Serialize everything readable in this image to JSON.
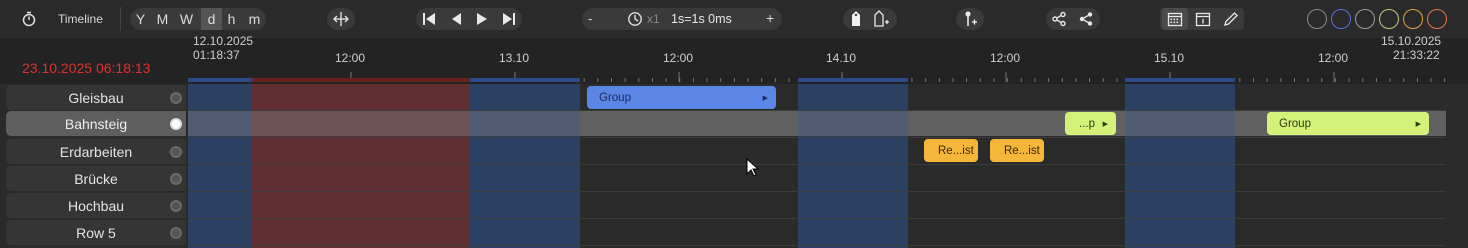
{
  "toolbar": {
    "timeline_label": "Timeline",
    "zoom_levels": [
      "Y",
      "M",
      "W",
      "d",
      "h",
      "m"
    ],
    "active_zoom": "d",
    "speed": {
      "minus": "-",
      "multiplier": "x1",
      "value": "1s=1s 0ms",
      "plus": "+"
    },
    "icons": {
      "stopwatch": "stopwatch-icon",
      "fit": "fit-width-icon",
      "skip_start": "skip-start-icon",
      "prev": "step-back-icon",
      "play": "play-icon",
      "skip_end": "skip-end-icon",
      "clock": "clock-icon",
      "tag": "tag-icon",
      "tag_add": "tag-add-icon",
      "pin_add": "pin-add-icon",
      "share": "share-icon",
      "share_add": "share-add-icon",
      "calendar_week": "calendar-grid-icon",
      "calendar": "calendar-icon",
      "pencil": "pencil-icon"
    },
    "color_circles": [
      "#8a8a8a",
      "#5a6fd6",
      "#9d9d9d",
      "#b9c97a",
      "#e0a43a",
      "#e07a50"
    ]
  },
  "ruler": {
    "current_time": "23.10.2025 06:18:13",
    "current_time_color": "#e03030",
    "start_date": "12.10.2025",
    "start_time": "01:18:37",
    "end_date": "15.10.2025",
    "end_time": "21:33:22",
    "ticks": [
      "12:00",
      "13.10",
      "12:00",
      "14.10",
      "12:00",
      "15.10",
      "12:00"
    ]
  },
  "rows": [
    {
      "label": "Gleisbau",
      "selected": false
    },
    {
      "label": "Bahnsteig",
      "selected": true
    },
    {
      "label": "Erdarbeiten",
      "selected": false
    },
    {
      "label": "Brücke",
      "selected": false
    },
    {
      "label": "Hochbau",
      "selected": false
    },
    {
      "label": "Row 5",
      "selected": false
    }
  ],
  "items": [
    {
      "label": "Group",
      "row": "Gleisbau",
      "color": "#5b86e6",
      "text_color": "#1a2a55"
    },
    {
      "label": "...p",
      "row": "Bahnsteig",
      "color": "#d4f27a",
      "text_color": "#2c3a10"
    },
    {
      "label": "Group",
      "row": "Bahnsteig",
      "color": "#d4f27a",
      "text_color": "#2c3a10"
    },
    {
      "label": "Re...ist",
      "row": "Erdarbeiten",
      "color": "#f5b73a",
      "text_color": "#3a2a05"
    },
    {
      "label": "Re...ist",
      "row": "Erdarbeiten",
      "color": "#f5b73a",
      "text_color": "#3a2a05"
    }
  ]
}
